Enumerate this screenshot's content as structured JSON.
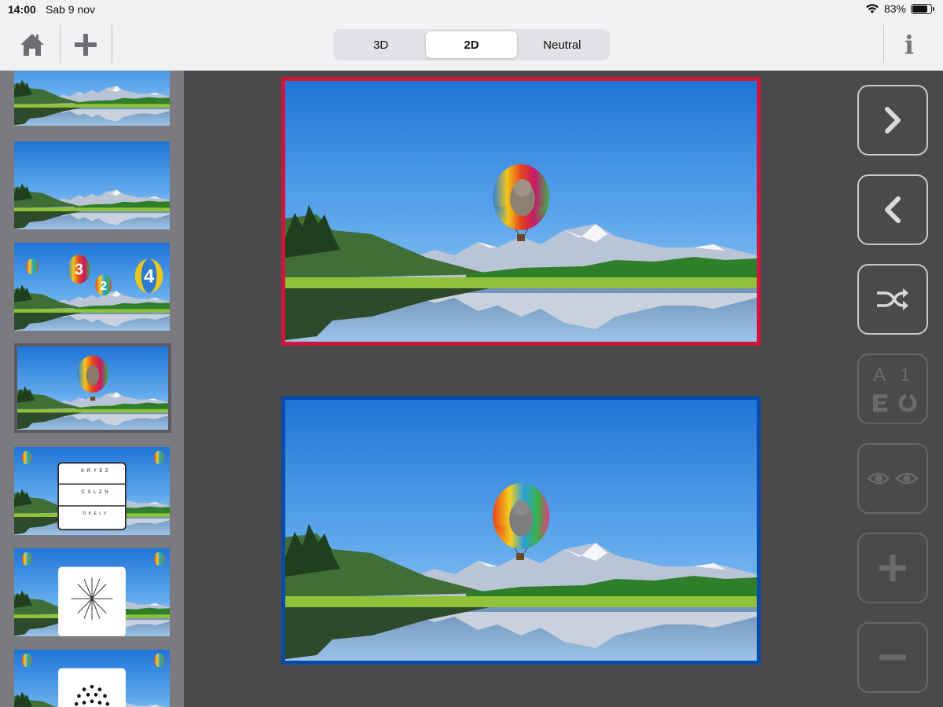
{
  "status": {
    "time": "14:00",
    "date": "Sab 9 nov",
    "battery": "83%",
    "battery_level": 0.83
  },
  "toolbar": {
    "home_icon": "home-icon",
    "add_icon": "plus-icon",
    "segments": [
      "3D",
      "2D",
      "Neutral"
    ],
    "active_segment": "2D",
    "info_label": "i"
  },
  "sidebar": {
    "selected_index": 3,
    "thumb3_balloon_labels": [
      "3",
      "2",
      "4"
    ],
    "thumb4_chart_rows": [
      "K R Y E Z",
      "C X L Z N",
      "O K E L V"
    ]
  },
  "controls": {
    "next": "chevron-right-icon",
    "prev": "chevron-left-icon",
    "shuffle": "shuffle-icon",
    "glyphs": [
      "A",
      "1"
    ],
    "eyes": "eyes-icon",
    "zoom_in": "plus-icon",
    "zoom_out": "minus-icon"
  },
  "colors": {
    "top_frame": "#d0143c",
    "bottom_frame": "#0a4aa8"
  }
}
